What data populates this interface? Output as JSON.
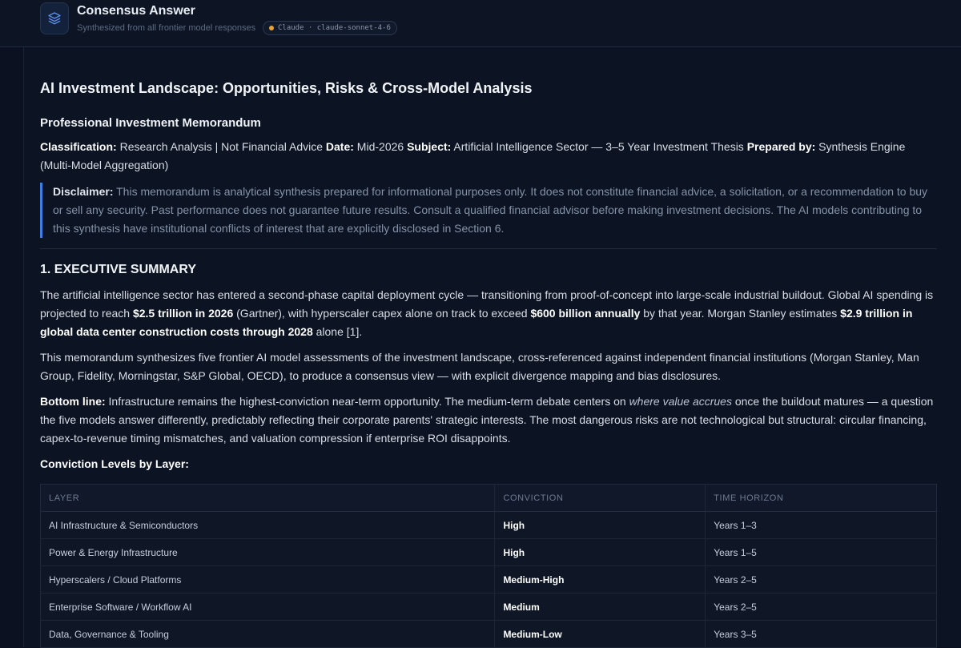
{
  "header": {
    "title": "Consensus Answer",
    "subtitle": "Synthesized from all frontier model responses",
    "model_badge": "Claude · claude-sonnet-4-6",
    "logo_icon": "layers-icon",
    "accent": "#e9a23b"
  },
  "doc": {
    "title": "AI Investment Landscape: Opportunities, Risks & Cross-Model Analysis",
    "subtitle": "Professional Investment Memorandum",
    "meta": {
      "classification_label": "Classification:",
      "classification": " Research Analysis | Not Financial Advice ",
      "date_label": "Date:",
      "date": " Mid-2026 ",
      "subject_label": "Subject:",
      "subject": " Artificial Intelligence Sector — 3–5 Year Investment Thesis ",
      "prepared_label": "Prepared by:",
      "prepared": " Synthesis Engine (Multi-Model Aggregation)"
    },
    "disclaimer": {
      "label": "Disclaimer:",
      "text": " This memorandum is analytical synthesis prepared for informational purposes only. It does not constitute financial advice, a solicitation, or a recommendation to buy or sell any security. Past performance does not guarantee future results. Consult a qualified financial advisor before making investment decisions. The AI models contributing to this synthesis have institutional conflicts of interest that are explicitly disclosed in Section 6."
    },
    "section1": {
      "heading": "1. EXECUTIVE SUMMARY",
      "p1": {
        "a": "The artificial intelligence sector has entered a second-phase capital deployment cycle — transitioning from proof-of-concept into large-scale industrial buildout. Global AI spending is projected to reach ",
        "b": "$2.5 trillion in 2026",
        "c": " (Gartner), with hyperscaler capex alone on track to exceed ",
        "d": "$600 billion annually",
        "e": " by that year. Morgan Stanley estimates ",
        "f": "$2.9 trillion in global data center construction costs through 2028",
        "g": " alone [1]."
      },
      "p2": "This memorandum synthesizes five frontier AI model assessments of the investment landscape, cross-referenced against independent financial institutions (Morgan Stanley, Man Group, Fidelity, Morningstar, S&P Global, OECD), to produce a consensus view — with explicit divergence mapping and bias disclosures.",
      "p3": {
        "label": "Bottom line:",
        "a": " Infrastructure remains the highest-conviction near-term opportunity. The medium-term debate centers on ",
        "em": "where value accrues",
        "b": " once the buildout matures — a question the five models answer differently, predictably reflecting their corporate parents' strategic interests. The most dangerous risks are not technological but structural: circular financing, capex-to-revenue timing mismatches, and valuation compression if enterprise ROI disappoints."
      },
      "conviction_title": "Conviction Levels by Layer:",
      "table": {
        "headers": [
          "LAYER",
          "CONVICTION",
          "TIME HORIZON"
        ],
        "rows": [
          [
            "AI Infrastructure & Semiconductors",
            "High",
            "Years 1–3"
          ],
          [
            "Power & Energy Infrastructure",
            "High",
            "Years 1–5"
          ],
          [
            "Hyperscalers / Cloud Platforms",
            "Medium-High",
            "Years 2–5"
          ],
          [
            "Enterprise Software / Workflow AI",
            "Medium",
            "Years 2–5"
          ],
          [
            "Data, Governance & Tooling",
            "Medium-Low",
            "Years 3–5"
          ]
        ]
      }
    }
  }
}
